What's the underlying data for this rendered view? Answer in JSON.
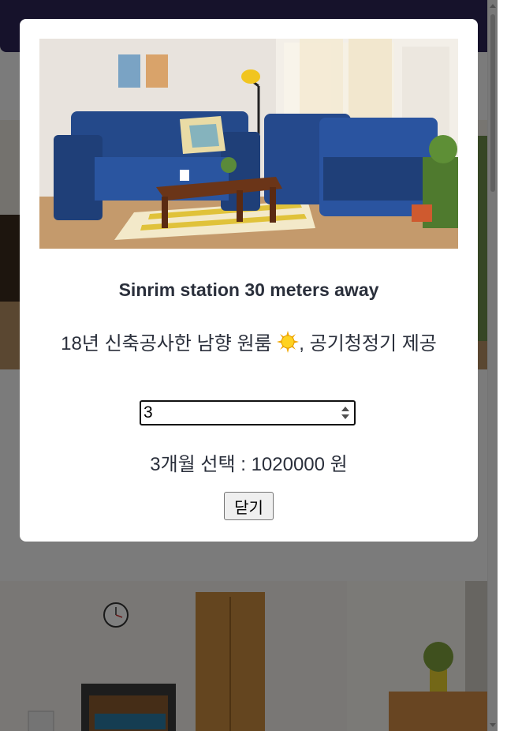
{
  "modal": {
    "title": "Sinrim station 30 meters away",
    "description_text": "18년 신축공사한 남향 원룸 ",
    "description_emoji": "sun-icon",
    "description_tail": ", 공기청정기 제공",
    "month_input_value": "3",
    "price_line": "3개월 선택 : 1020000 원",
    "close_label": "닫기"
  },
  "colors": {
    "nav_bg": "#2c2456",
    "overlay": "rgba(0,0,0,0.5)",
    "text": "#2a2f3b"
  }
}
